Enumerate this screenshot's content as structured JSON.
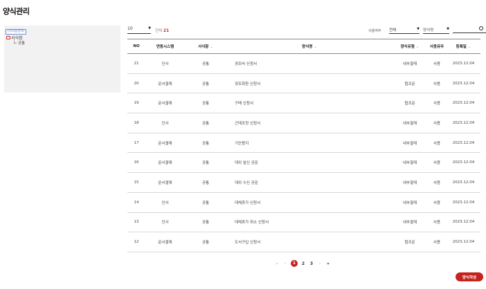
{
  "page": {
    "title": "양식관리"
  },
  "tree": {
    "badge": "[서식함관리]",
    "root_label": "서식함",
    "child_label": "공통"
  },
  "toolbar": {
    "page_size": "10",
    "total_label": "전체",
    "total_count": "21",
    "filter_label": "사용여부",
    "filter_value": "전체",
    "search_field": "양식명",
    "search_placeholder": ""
  },
  "table": {
    "headers": {
      "no": "NO",
      "sys": "연동시스템",
      "type": "서식함",
      "name": "양식명",
      "kind": "양식유형",
      "use": "사용유무",
      "date": "등록일"
    },
    "sort_icon": "⌄",
    "rows": [
      {
        "no": "21",
        "sys": "인사",
        "type": "공통",
        "name": "경조비 신청서",
        "kind": "내부결재",
        "use": "사용",
        "date": "2023.12.04"
      },
      {
        "no": "20",
        "sys": "문서결재",
        "type": "공통",
        "name": "경조화환 신청서",
        "kind": "협조문",
        "use": "사용",
        "date": "2023.12.04"
      },
      {
        "no": "19",
        "sys": "문서결재",
        "type": "공통",
        "name": "구매 신청서",
        "kind": "협조문",
        "use": "사용",
        "date": "2023.12.04"
      },
      {
        "no": "18",
        "sys": "인사",
        "type": "공통",
        "name": "근태조정 신청서",
        "kind": "내부결재",
        "use": "사용",
        "date": "2023.12.04"
      },
      {
        "no": "17",
        "sys": "문서결재",
        "type": "공통",
        "name": "기안용지",
        "kind": "내부결재",
        "use": "사용",
        "date": "2023.12.04"
      },
      {
        "no": "16",
        "sys": "문서결재",
        "type": "공통",
        "name": "대외 발신 공문",
        "kind": "내부결재",
        "use": "사용",
        "date": "2023.12.04"
      },
      {
        "no": "15",
        "sys": "문서결재",
        "type": "공통",
        "name": "대외 수신 공문",
        "kind": "내부결재",
        "use": "사용",
        "date": "2023.12.04"
      },
      {
        "no": "14",
        "sys": "인사",
        "type": "공통",
        "name": "대체휴가 신청서",
        "kind": "내부결재",
        "use": "사용",
        "date": "2023.12.04"
      },
      {
        "no": "13",
        "sys": "인사",
        "type": "공통",
        "name": "대체휴가 취소 신청서",
        "kind": "내부결재",
        "use": "사용",
        "date": "2023.12.04"
      },
      {
        "no": "12",
        "sys": "문서결재",
        "type": "공통",
        "name": "도서구입 신청서",
        "kind": "협조문",
        "use": "사용",
        "date": "2023.12.04"
      }
    ]
  },
  "pager": {
    "first": "«",
    "prev": "‹",
    "pages": [
      "1",
      "2",
      "3"
    ],
    "active": "1",
    "next": "›",
    "last": "»"
  },
  "actions": {
    "create_label": "양식작성"
  },
  "colors": {
    "accent": "#c5231d"
  }
}
